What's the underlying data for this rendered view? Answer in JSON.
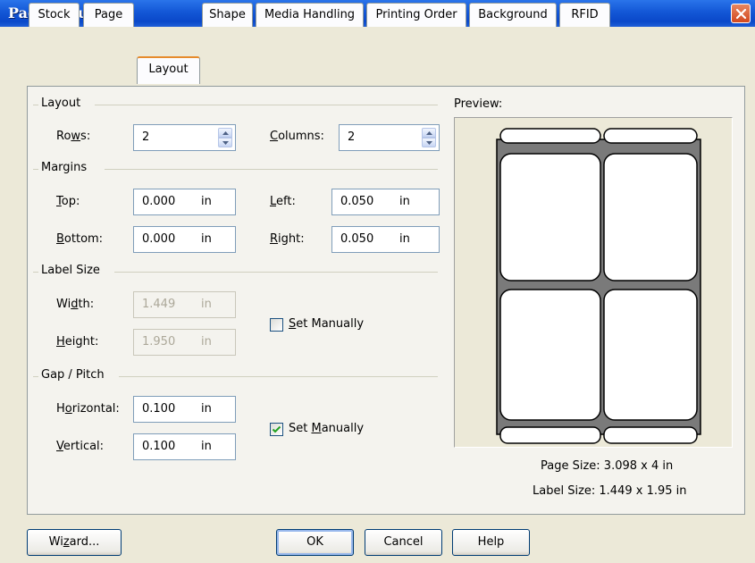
{
  "window": {
    "title": "Page Setup"
  },
  "tabs": [
    {
      "label": "Stock"
    },
    {
      "label": "Page"
    },
    {
      "label": "Layout",
      "active": true
    },
    {
      "label": "Shape"
    },
    {
      "label": "Media Handling"
    },
    {
      "label": "Printing Order"
    },
    {
      "label": "Background"
    },
    {
      "label": "RFID"
    }
  ],
  "layout": {
    "section_label": "Layout",
    "rows_label": "Rows:",
    "rows_value": "2",
    "columns_label": "Columns:",
    "columns_value": "2"
  },
  "margins": {
    "section_label": "Margins",
    "top_label": "Top:",
    "top_value": "0.000",
    "top_unit": "in",
    "bottom_label": "Bottom:",
    "bottom_value": "0.000",
    "bottom_unit": "in",
    "left_label": "Left:",
    "left_value": "0.050",
    "left_unit": "in",
    "right_label": "Right:",
    "right_value": "0.050",
    "right_unit": "in"
  },
  "label_size": {
    "section_label": "Label Size",
    "width_label": "Width:",
    "width_value": "1.449",
    "width_unit": "in",
    "height_label": "Height:",
    "height_value": "1.950",
    "height_unit": "in",
    "set_manually_label": "Set Manually",
    "set_manually_checked": false
  },
  "gap_pitch": {
    "section_label": "Gap / Pitch",
    "horizontal_label": "Horizontal:",
    "horizontal_value": "0.100",
    "horizontal_unit": "in",
    "vertical_label": "Vertical:",
    "vertical_value": "0.100",
    "vertical_unit": "in",
    "set_manually_label": "Set Manually",
    "set_manually_checked": true
  },
  "preview": {
    "label": "Preview:",
    "page_size": "Page Size:  3.098 x 4 in",
    "label_size": "Label Size:  1.449 x 1.95 in"
  },
  "buttons": {
    "wizard": "Wizard...",
    "ok": "OK",
    "cancel": "Cancel",
    "help": "Help"
  },
  "colors": {
    "titlebar": "#0a48c9",
    "tab_highlight": "#e68b2c",
    "checkmark": "#21a121"
  }
}
